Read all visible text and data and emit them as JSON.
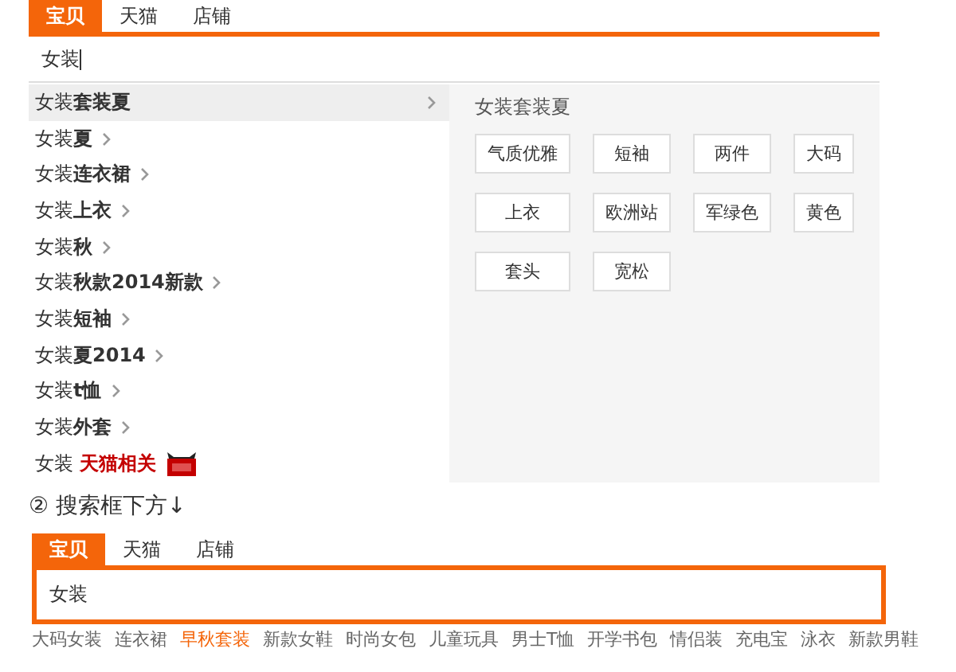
{
  "top_search": {
    "tabs": [
      {
        "label": "宝贝",
        "selected": true
      },
      {
        "label": "天猫",
        "selected": false
      },
      {
        "label": "店铺",
        "selected": false
      }
    ],
    "query": "女装",
    "focused": true,
    "suggestions": [
      {
        "kind": "suggestion",
        "text": "女装**套装夏**",
        "selected": true
      },
      {
        "kind": "suggestion",
        "text": "女装**夏**",
        "selected": false
      },
      {
        "kind": "suggestion",
        "text": "女装**连衣裙**",
        "selected": false
      },
      {
        "kind": "suggestion",
        "text": "女装**上衣**",
        "selected": false
      },
      {
        "kind": "suggestion",
        "text": "女装**秋**",
        "selected": false
      },
      {
        "kind": "suggestion",
        "text": "女装**秋款2014新款**",
        "selected": false
      },
      {
        "kind": "suggestion",
        "text": "女装**短袖**",
        "selected": false
      },
      {
        "kind": "suggestion",
        "text": "女装**夏2014**",
        "selected": false
      },
      {
        "kind": "suggestion",
        "text": "女装**t恤**",
        "selected": false
      },
      {
        "kind": "suggestion",
        "text": "女装**外套**",
        "selected": false
      },
      {
        "kind": "tmall",
        "prefix": "女装",
        "label": "天猫相关",
        "selected": false
      }
    ],
    "panel": {
      "title": "女装套装夏",
      "tags": [
        "气质优雅",
        "短袖",
        "两件",
        "大码",
        "上衣",
        "欧洲站",
        "军绿色",
        "黄色",
        "套头",
        "宽松"
      ]
    }
  },
  "note": "② 搜索框下方↓",
  "bottom_search": {
    "tabs": [
      {
        "label": "宝贝",
        "selected": true
      },
      {
        "label": "天猫",
        "selected": false
      },
      {
        "label": "店铺",
        "selected": false
      }
    ],
    "query": "女装",
    "hot_words": [
      {
        "text": "大码女装",
        "highlighted": false
      },
      {
        "text": "连衣裙",
        "highlighted": false
      },
      {
        "text": "早秋套装",
        "highlighted": true
      },
      {
        "text": "新款女鞋",
        "highlighted": false
      },
      {
        "text": "时尚女包",
        "highlighted": false
      },
      {
        "text": "儿童玩具",
        "highlighted": false
      },
      {
        "text": "男士T恤",
        "highlighted": false
      },
      {
        "text": "开学书包",
        "highlighted": false
      },
      {
        "text": "情侣装",
        "highlighted": false
      },
      {
        "text": "充电宝",
        "highlighted": false
      },
      {
        "text": "泳衣",
        "highlighted": false
      },
      {
        "text": "新款男鞋",
        "highlighted": false
      }
    ]
  }
}
